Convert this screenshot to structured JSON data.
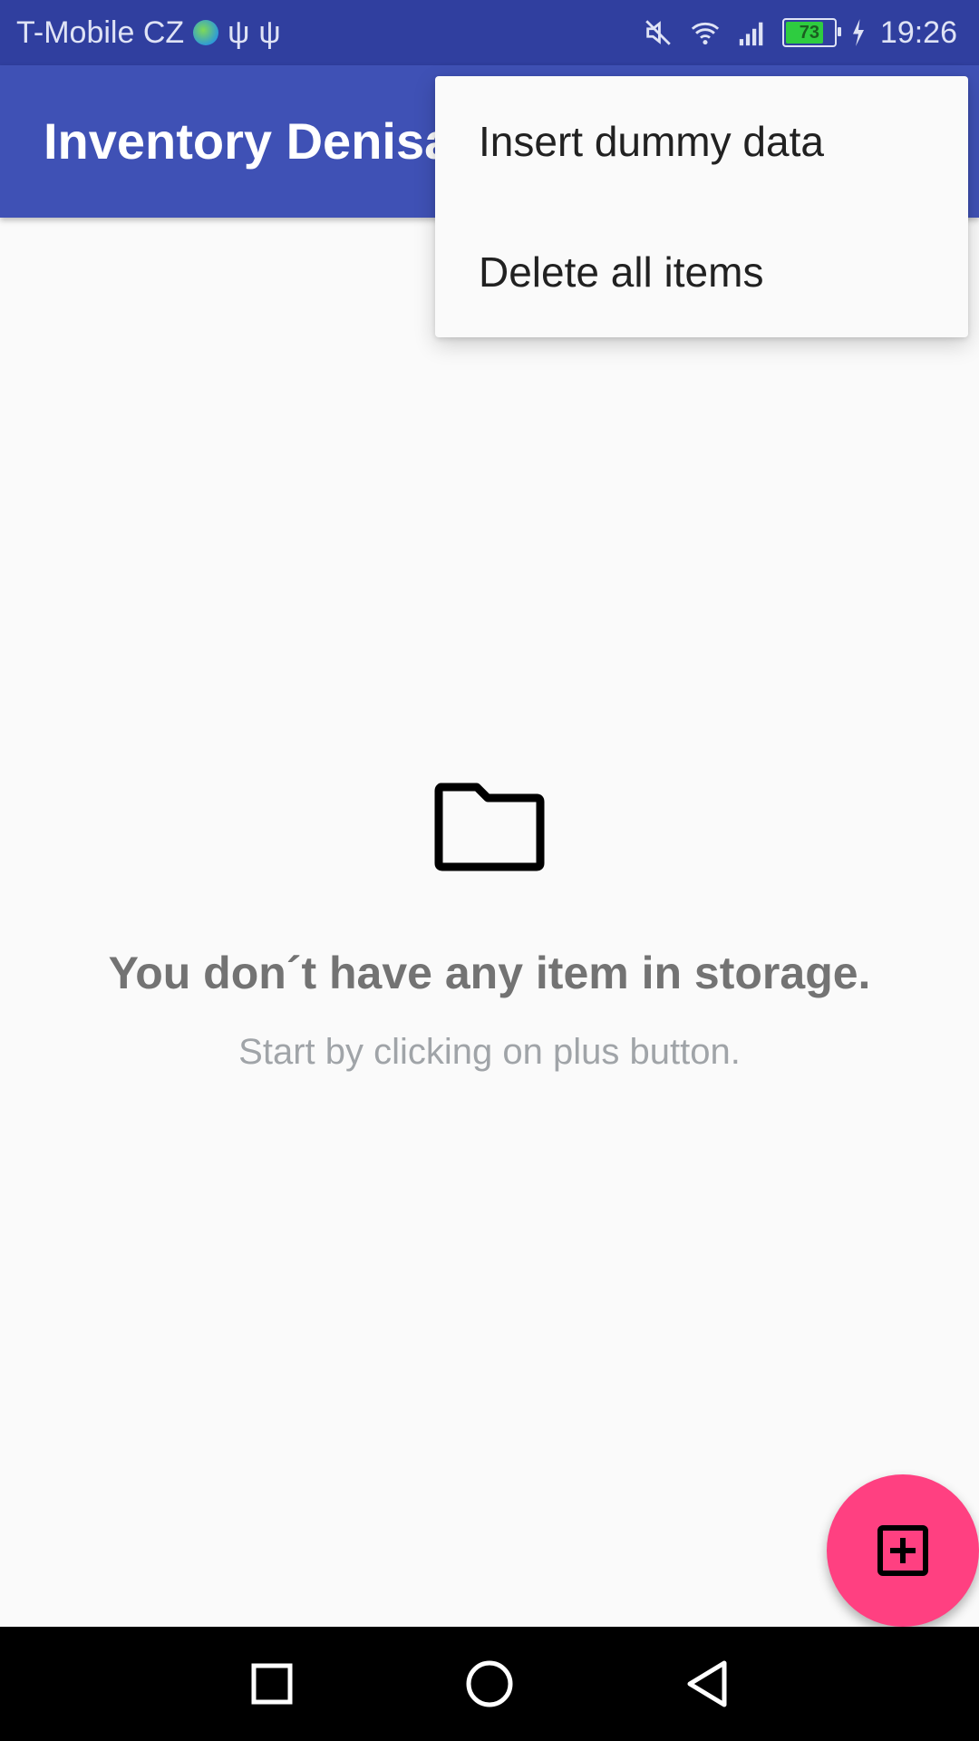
{
  "status_bar": {
    "carrier": "T-Mobile CZ",
    "battery_level": "73",
    "time": "19:26",
    "icons": [
      "globe-icon",
      "usb-icon",
      "usb-icon",
      "mute-icon",
      "wifi-icon",
      "signal-icon",
      "battery-icon",
      "charging-icon"
    ]
  },
  "app_bar": {
    "title": "Inventory Denisa"
  },
  "overflow_menu": {
    "items": [
      {
        "label": "Insert dummy data"
      },
      {
        "label": "Delete all items"
      }
    ]
  },
  "empty_state": {
    "icon": "folder-icon",
    "title": "You don´t have any item in storage.",
    "subtitle": "Start by clicking on plus button."
  },
  "fab": {
    "icon": "add-box-icon",
    "color": "#ff4081"
  },
  "nav_bar": {
    "icons": [
      "recents-icon",
      "home-icon",
      "back-icon"
    ]
  },
  "colors": {
    "status_bar": "#303f9f",
    "app_bar": "#3f51b5",
    "background": "#fafafa"
  }
}
